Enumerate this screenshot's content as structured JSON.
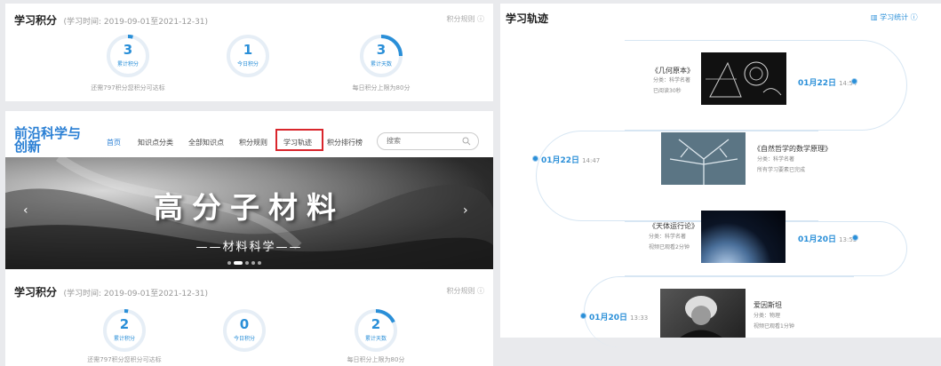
{
  "points_panel_top": {
    "title": "学习积分",
    "period": "(学习时间: 2019-09-01至2021-12-31)",
    "rule": "积分规则 ⓘ",
    "circles": [
      {
        "value": "3",
        "label": "累计积分",
        "progress": 0.04
      },
      {
        "value": "1",
        "label": "今日积分",
        "progress": 0.0
      },
      {
        "value": "3",
        "label": "累计天数",
        "progress": 0.25
      }
    ],
    "left_caption": "还需797积分您积分可达标",
    "right_caption": "每日积分上限为80分"
  },
  "nav": {
    "brand": "前沿科学与创新",
    "items": [
      "首页",
      "知识点分类",
      "全部知识点",
      "积分规则",
      "学习轨迹",
      "积分排行榜"
    ],
    "highlighted": "学习轨迹",
    "search_placeholder": "搜索"
  },
  "banner": {
    "title": "高分子材料",
    "subtitle": "——材料科学——",
    "prev": "‹",
    "next": "›",
    "slide_count": 5,
    "active_slide": 1
  },
  "points_panel_bottom": {
    "title": "学习积分",
    "period": "(学习时间: 2019-09-01至2021-12-31)",
    "rule": "积分规则 ⓘ",
    "circles": [
      {
        "value": "2",
        "label": "累计积分",
        "progress": 0.03
      },
      {
        "value": "0",
        "label": "今日积分",
        "progress": 0.0
      },
      {
        "value": "2",
        "label": "累计天数",
        "progress": 0.18
      }
    ],
    "left_caption": "还需797积分您积分可达标",
    "right_caption": "每日积分上限为80分"
  },
  "track": {
    "title": "学习轨迹",
    "stat_link": "▥ 学习统计 ⓘ",
    "entries": [
      {
        "name": "《几何原本》",
        "category": "分类：科学名著",
        "status": "已阅读30秒",
        "date": "01月22日",
        "time": "14:54"
      },
      {
        "name": "《自然哲学的数学原理》",
        "category": "分类：科学名著",
        "status": "所有学习要素已完成",
        "date": "01月22日",
        "time": "14:47"
      },
      {
        "name": "《天体运行论》",
        "category": "分类：科学名著",
        "status": "视频已观看2分钟",
        "date": "01月20日",
        "time": "13:53"
      },
      {
        "name": "爱因斯坦",
        "category": "分类：物理",
        "status": "视频已观看1分钟",
        "date": "01月20日",
        "time": "13:33"
      }
    ]
  },
  "colors": {
    "accent": "#2a8fd8",
    "highlight_border": "#d9262c",
    "ring_bg": "#e6eef6"
  }
}
